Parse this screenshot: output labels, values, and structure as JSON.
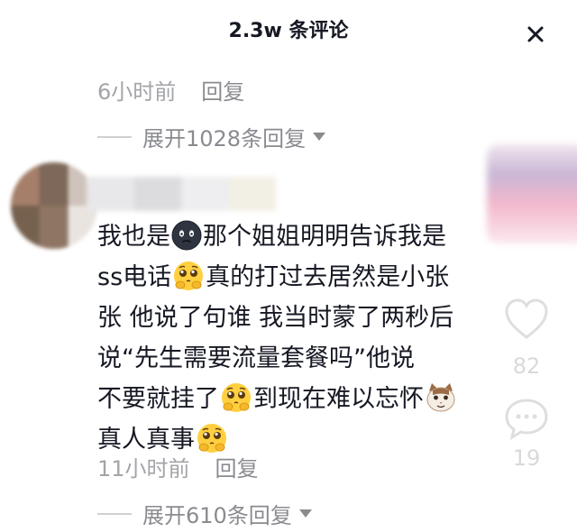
{
  "header": {
    "title": "2.3w 条评论"
  },
  "top_comment": {
    "time": "6小时前",
    "reply_label": "回复",
    "expand_label": "展开1028条回复"
  },
  "comment": {
    "segments": [
      "我也是",
      "那个姐姐明明告诉我是",
      "ss电话",
      "真的打过去居然是小张",
      "张 他说了句谁 我当时蒙了两秒后",
      "说“先生需要流量套餐吗”他说",
      "不要就挂了",
      "到现在难以忘怀",
      "真人真事"
    ],
    "time": "11小时前",
    "reply_label": "回复",
    "expand_label": "展开610条回复",
    "likes": "82",
    "replies": "19"
  },
  "icons": {
    "close": "close-icon",
    "expand": "chevron-down-icon",
    "heart": "heart-icon",
    "reply": "comment-bubble-icon",
    "emoji_dark": "dark-face-emoji-icon",
    "emoji_plead": "pleading-face-emoji-icon",
    "emoji_cat": "cat-face-emoji-icon"
  },
  "colors": {
    "text": "#161823",
    "muted": "#a3a4a8",
    "secondary": "#8a8b90",
    "faint_icon": "#d9d9dc"
  }
}
